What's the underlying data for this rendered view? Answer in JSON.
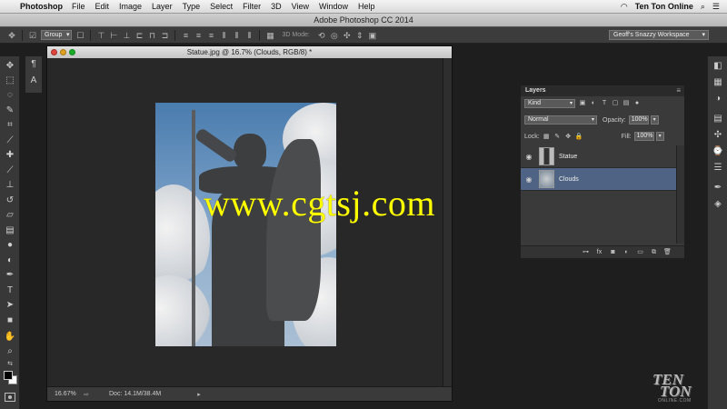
{
  "menubar": {
    "app": "Photoshop",
    "items": [
      "File",
      "Edit",
      "Image",
      "Layer",
      "Type",
      "Select",
      "Filter",
      "3D",
      "View",
      "Window",
      "Help"
    ],
    "right_label": "Ten Ton Online"
  },
  "app_title": "Adobe Photoshop CC 2014",
  "options": {
    "auto_select_value": "Group",
    "mode_3d_label": "3D Mode:",
    "workspace": "Geoff's Snazzy Workspace"
  },
  "document": {
    "title": "Statue.jpg @ 16.7% (Clouds, RGB/8) *",
    "zoom": "16.67%",
    "doc_size": "Doc: 14.1M/38.4M"
  },
  "watermark": "www.cgtsj.com",
  "layers_panel": {
    "tab_label": "Layers",
    "filter_kind": "Kind",
    "blend_mode": "Normal",
    "opacity_label": "Opacity:",
    "opacity_value": "100%",
    "lock_label": "Lock:",
    "fill_label": "Fill:",
    "fill_value": "100%",
    "layers": [
      {
        "name": "Statue",
        "selected": false
      },
      {
        "name": "Clouds",
        "selected": true
      }
    ]
  },
  "logo": {
    "line1": "TEN",
    "line2": "TON",
    "sub": "ONLINE.COM"
  },
  "colors": {
    "selection": "#4f6484",
    "watermark": "#ffff00"
  }
}
